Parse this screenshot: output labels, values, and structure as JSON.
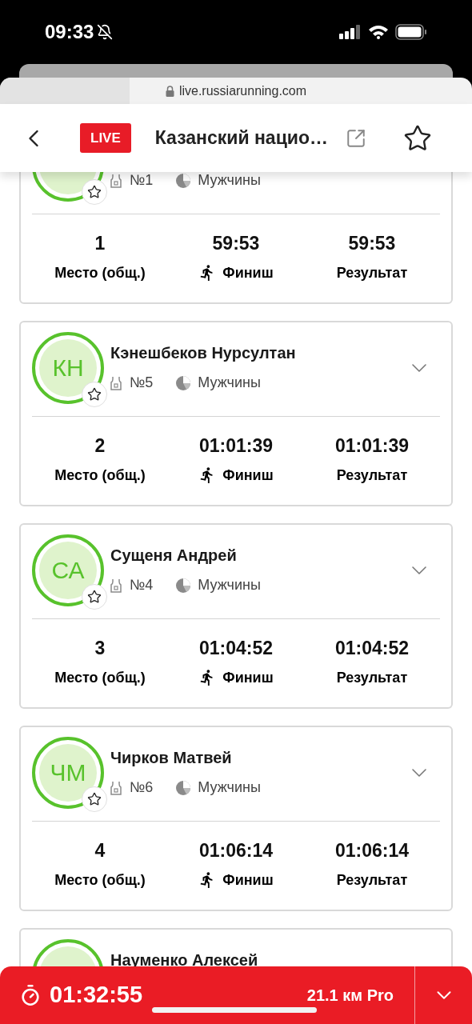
{
  "status_bar": {
    "time": "09:33"
  },
  "browser": {
    "url": "live.russiarunning.com"
  },
  "header": {
    "badge": "LIVE",
    "title": "Казанский нацио…"
  },
  "results": [
    {
      "bib": "№1",
      "category": "Мужчины",
      "stats": [
        {
          "kind": "place",
          "value": "1",
          "label": "Место (общ.)"
        },
        {
          "kind": "finish",
          "value": "59:53",
          "label": "Финиш"
        },
        {
          "kind": "result",
          "value": "59:53",
          "label": "Результат"
        }
      ]
    },
    {
      "initials": "КН",
      "name": "Кэнешбеков Нурсултан",
      "bib": "№5",
      "category": "Мужчины",
      "stats": [
        {
          "kind": "place",
          "value": "2",
          "label": "Место (общ.)"
        },
        {
          "kind": "finish",
          "value": "01:01:39",
          "label": "Финиш"
        },
        {
          "kind": "result",
          "value": "01:01:39",
          "label": "Результат"
        }
      ]
    },
    {
      "initials": "СА",
      "name": "Сущеня Андрей",
      "bib": "№4",
      "category": "Мужчины",
      "stats": [
        {
          "kind": "place",
          "value": "3",
          "label": "Место (общ.)"
        },
        {
          "kind": "finish",
          "value": "01:04:52",
          "label": "Финиш"
        },
        {
          "kind": "result",
          "value": "01:04:52",
          "label": "Результат"
        }
      ]
    },
    {
      "initials": "ЧМ",
      "name": "Чирков Матвей",
      "bib": "№6",
      "category": "Мужчины",
      "stats": [
        {
          "kind": "place",
          "value": "4",
          "label": "Место (общ.)"
        },
        {
          "kind": "finish",
          "value": "01:06:14",
          "label": "Финиш"
        },
        {
          "kind": "result",
          "value": "01:06:14",
          "label": "Результат"
        }
      ]
    },
    {
      "name": "Науменко Алексей"
    }
  ],
  "race_bar": {
    "timer": "01:32:55",
    "distance": "21.1 км Pro"
  }
}
